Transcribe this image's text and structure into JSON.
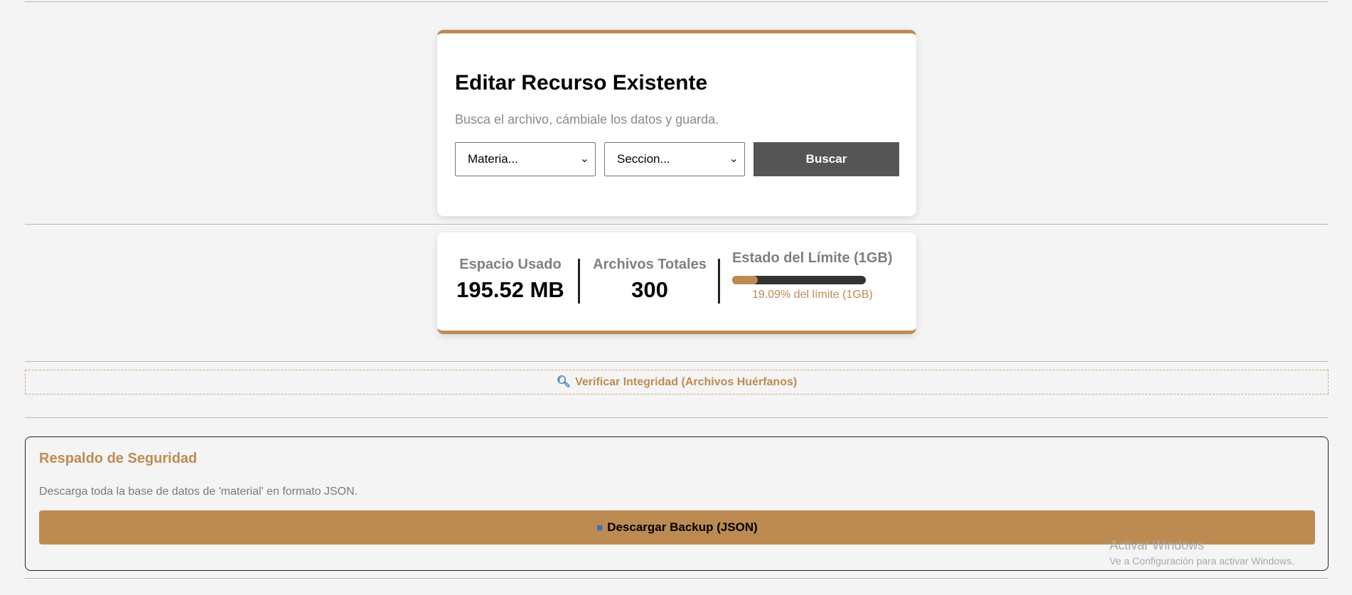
{
  "editor": {
    "title": "Editar Recurso Existente",
    "subtitle": "Busca el archivo, cámbiale los datos y guarda.",
    "materia_select": "Materia...",
    "seccion_select": "Seccion...",
    "search_button": "Buscar",
    "chevron_icon": "chevron-down-icon"
  },
  "stats": {
    "used_label": "Espacio Usado",
    "used_value": "195.52 MB",
    "files_label": "Archivos Totales",
    "files_value": "300",
    "limit_label": "Estado del Límite (1GB)",
    "limit_fraction": 0.1909,
    "limit_text": "19.09% del límite (1GB)"
  },
  "integrity": {
    "icon": "magnifier-icon",
    "label": "Verificar Integridad (Archivos Huérfanos)"
  },
  "backup": {
    "title": "Respaldo de Seguridad",
    "description": "Descarga toda la base de datos de 'material' en formato JSON.",
    "button_icon": "package-icon",
    "button_label": "Descargar Backup (JSON)"
  },
  "watermark": {
    "title": "Activar Windows",
    "subtitle": "Ve a Configuración para activar Windows."
  },
  "colors": {
    "accent": "#bd8b52",
    "background": "#f4f4f4",
    "dark_button": "#555555"
  }
}
